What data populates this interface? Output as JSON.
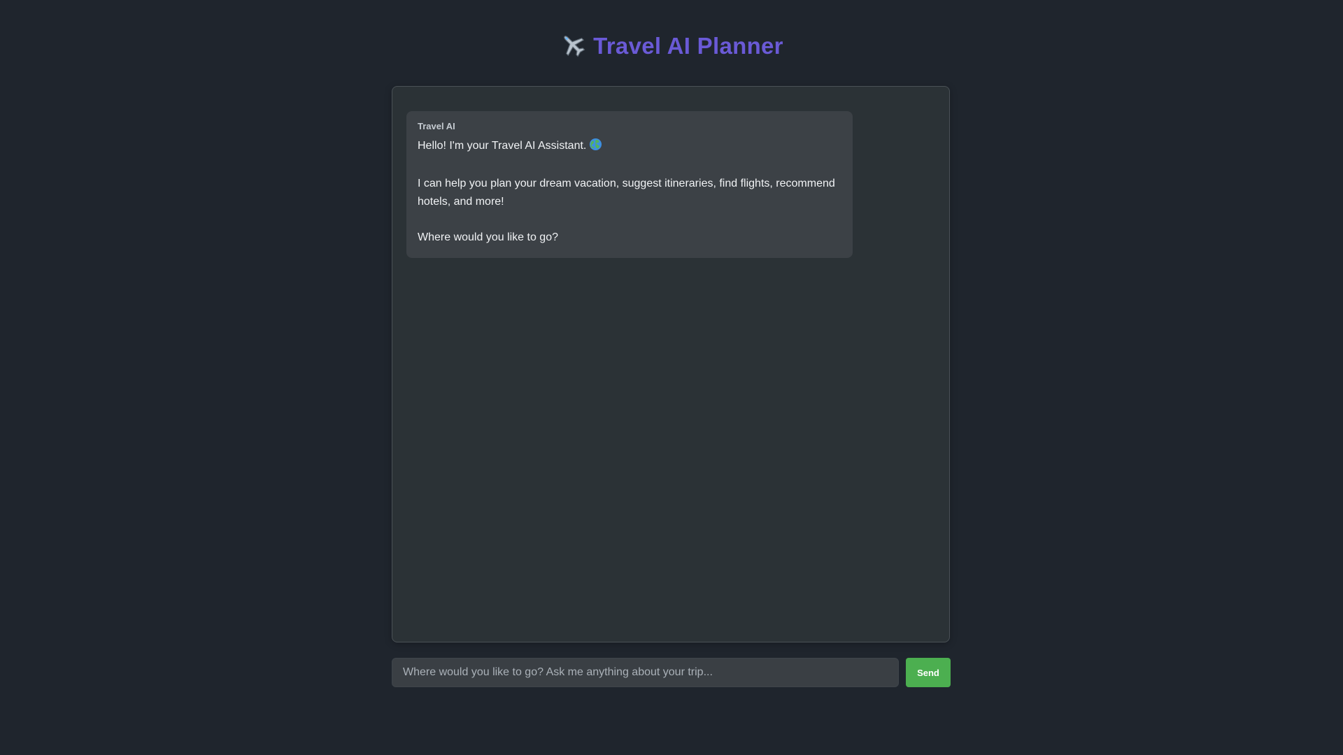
{
  "header": {
    "icon": "airplane-icon",
    "title": "Travel AI Planner"
  },
  "chat": {
    "messages": [
      {
        "sender": "Travel AI",
        "lines": [
          "Hello! I'm your Travel AI Assistant.",
          "",
          "I can help you plan your dream vacation, suggest itineraries, find flights, recommend hotels, and more!",
          "",
          "Where would you like to go?"
        ],
        "icon": "globe-icon"
      }
    ]
  },
  "input": {
    "value": "",
    "placeholder": "Where would you like to go? Ask me anything about your trip..."
  },
  "send_button": {
    "label": "Send"
  },
  "colors": {
    "page_background": "#1f252d",
    "title": "#6a5ad6",
    "chat_background": "#2b3236",
    "message_background": "#3c4146",
    "send_button": "#4caf50"
  }
}
